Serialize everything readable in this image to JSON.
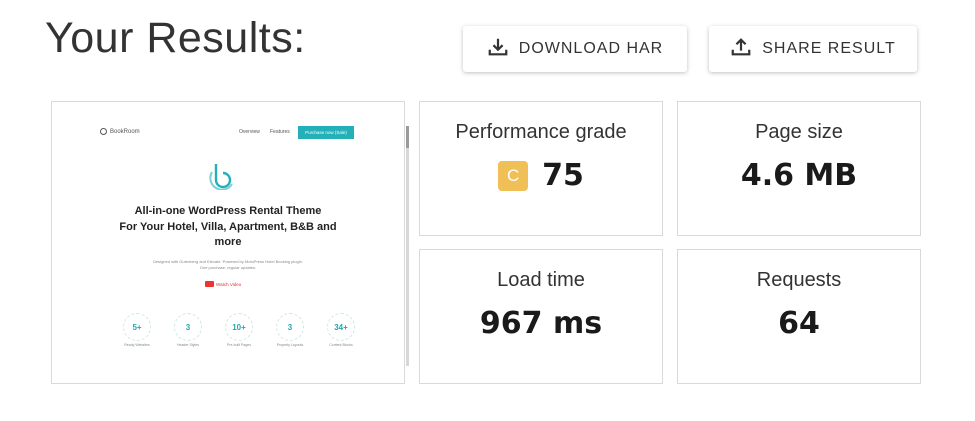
{
  "header": {
    "title": "Your Results:",
    "download_label": "DOWNLOAD HAR",
    "share_label": "SHARE RESULT",
    "download_icon": "download-icon",
    "share_icon": "share-icon"
  },
  "metrics": {
    "performance": {
      "label": "Performance grade",
      "grade": "C",
      "value": "75",
      "grade_color": "#f0bf56"
    },
    "page_size": {
      "label": "Page size",
      "value": "4.6 MB"
    },
    "load_time": {
      "label": "Load time",
      "value": "967 ms"
    },
    "requests": {
      "label": "Requests",
      "value": "64"
    }
  },
  "preview": {
    "logo_text": "BookRoom",
    "nav": [
      "Overview",
      "Features"
    ],
    "cta": "Purchase now (Sale)",
    "heading_lines": [
      "All-in-one WordPress Rental Theme",
      "For Your Hotel, Villa, Apartment, B&B and",
      "more"
    ],
    "subtext_lines": [
      "Designed with Gutenberg and Elevate. Powered by MotoPress Hotel Booking plugin.",
      "One purchase, regular updates."
    ],
    "video_label": "Watch Video",
    "accent_color": "#23b0b8",
    "stats": [
      {
        "value": "5+",
        "label": "Ready Websites"
      },
      {
        "value": "3",
        "label": "Header Styles"
      },
      {
        "value": "10+",
        "label": "Pre-built Pages"
      },
      {
        "value": "3",
        "label": "Property Layouts"
      },
      {
        "value": "34+",
        "label": "Content Blocks"
      }
    ]
  }
}
